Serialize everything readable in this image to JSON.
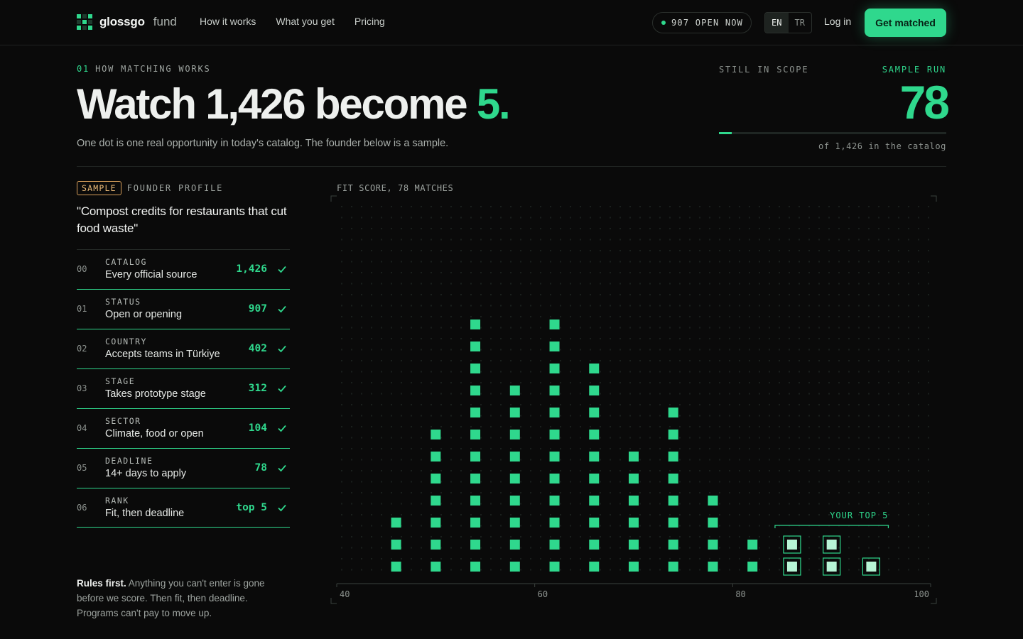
{
  "nav": {
    "brand": "glossgo",
    "brand_sub": "fund",
    "links": [
      "How it works",
      "What you get",
      "Pricing"
    ],
    "open_now": "907 OPEN NOW",
    "lang": [
      "EN",
      "TR"
    ],
    "login": "Log in",
    "cta": "Get matched"
  },
  "hero": {
    "kicker_num": "01",
    "kicker": "HOW MATCHING WORKS",
    "headline_main": "Watch 1,426 become ",
    "headline_accent": "5.",
    "subline": "One dot is one real opportunity in today's catalog. The founder below is a sample.",
    "scope_label": "STILL IN SCOPE",
    "run_label": "SAMPLE RUN",
    "count": "78",
    "progress": 0.055,
    "of_catalog": "of 1,426 in the catalog"
  },
  "profile": {
    "badge": "SAMPLE",
    "label": "FOUNDER PROFILE",
    "quote": "\"Compost credits for restaurants that cut food waste\"",
    "steps": [
      {
        "idx": "00",
        "cap": "CATALOG",
        "desc": "Every official source",
        "val": "1,426"
      },
      {
        "idx": "01",
        "cap": "STATUS",
        "desc": "Open or opening",
        "val": "907"
      },
      {
        "idx": "02",
        "cap": "COUNTRY",
        "desc": "Accepts teams in Türkiye",
        "val": "402"
      },
      {
        "idx": "03",
        "cap": "STAGE",
        "desc": "Takes prototype stage",
        "val": "312"
      },
      {
        "idx": "04",
        "cap": "SECTOR",
        "desc": "Climate, food or open",
        "val": "104"
      },
      {
        "idx": "05",
        "cap": "DEADLINE",
        "desc": "14+ days to apply",
        "val": "78"
      },
      {
        "idx": "06",
        "cap": "RANK",
        "desc": "Fit, then deadline",
        "val": "top 5"
      }
    ],
    "rules_bold": "Rules first.",
    "rules_text": " Anything you can't enter is gone before we score. Then fit, then deadline. Programs can't pay to move up."
  },
  "chart_data": {
    "type": "scatter",
    "title": "FIT SCORE, 78 MATCHES",
    "xlim": [
      40,
      100
    ],
    "x_ticks": [
      40,
      60,
      80,
      100
    ],
    "bins": [
      46,
      50,
      54,
      58,
      62,
      66,
      70,
      74,
      78,
      82,
      86,
      90,
      94
    ],
    "counts": [
      3,
      7,
      12,
      9,
      12,
      10,
      6,
      8,
      4,
      2,
      2,
      2,
      1
    ],
    "top_counts": [
      0,
      0,
      0,
      0,
      0,
      0,
      0,
      0,
      0,
      0,
      2,
      2,
      1
    ],
    "annotation": "YOUR TOP 5",
    "colors": {
      "dot": "#2fd88d",
      "top": "#b7f5d6",
      "grid": "#1a201d"
    }
  }
}
